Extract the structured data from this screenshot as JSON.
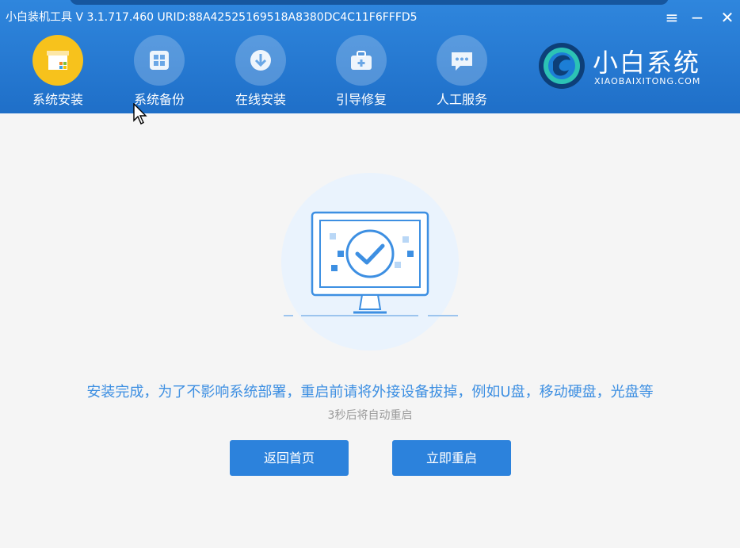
{
  "window": {
    "title": "小白装机工具 V 3.1.717.460 URID:88A42525169518A8380DC4C11F6FFFD5",
    "menu_glyph": "≡",
    "minimize_glyph": "−",
    "close_glyph": "✕"
  },
  "nav": {
    "items": [
      {
        "label": "系统安装",
        "icon": "install-box-icon",
        "active": true
      },
      {
        "label": "系统备份",
        "icon": "backup-windows-icon",
        "active": false
      },
      {
        "label": "在线安装",
        "icon": "download-icon",
        "active": false
      },
      {
        "label": "引导修复",
        "icon": "toolbox-icon",
        "active": false
      },
      {
        "label": "人工服务",
        "icon": "chat-icon",
        "active": false
      }
    ]
  },
  "brand": {
    "name": "小白系统",
    "sub": "XIAOBAIXITONG.COM"
  },
  "main": {
    "message": "安装完成，为了不影响系统部署，重启前请将外接设备拔掉，例如U盘，移动硬盘，光盘等",
    "countdown": "3秒后将自动重启"
  },
  "buttons": {
    "back_home": "返回首页",
    "restart_now": "立即重启"
  },
  "colors": {
    "header_blue": "#2478d4",
    "active_nav": "#f7c21c",
    "accent": "#3d8fe2",
    "button": "#2c82dc"
  }
}
